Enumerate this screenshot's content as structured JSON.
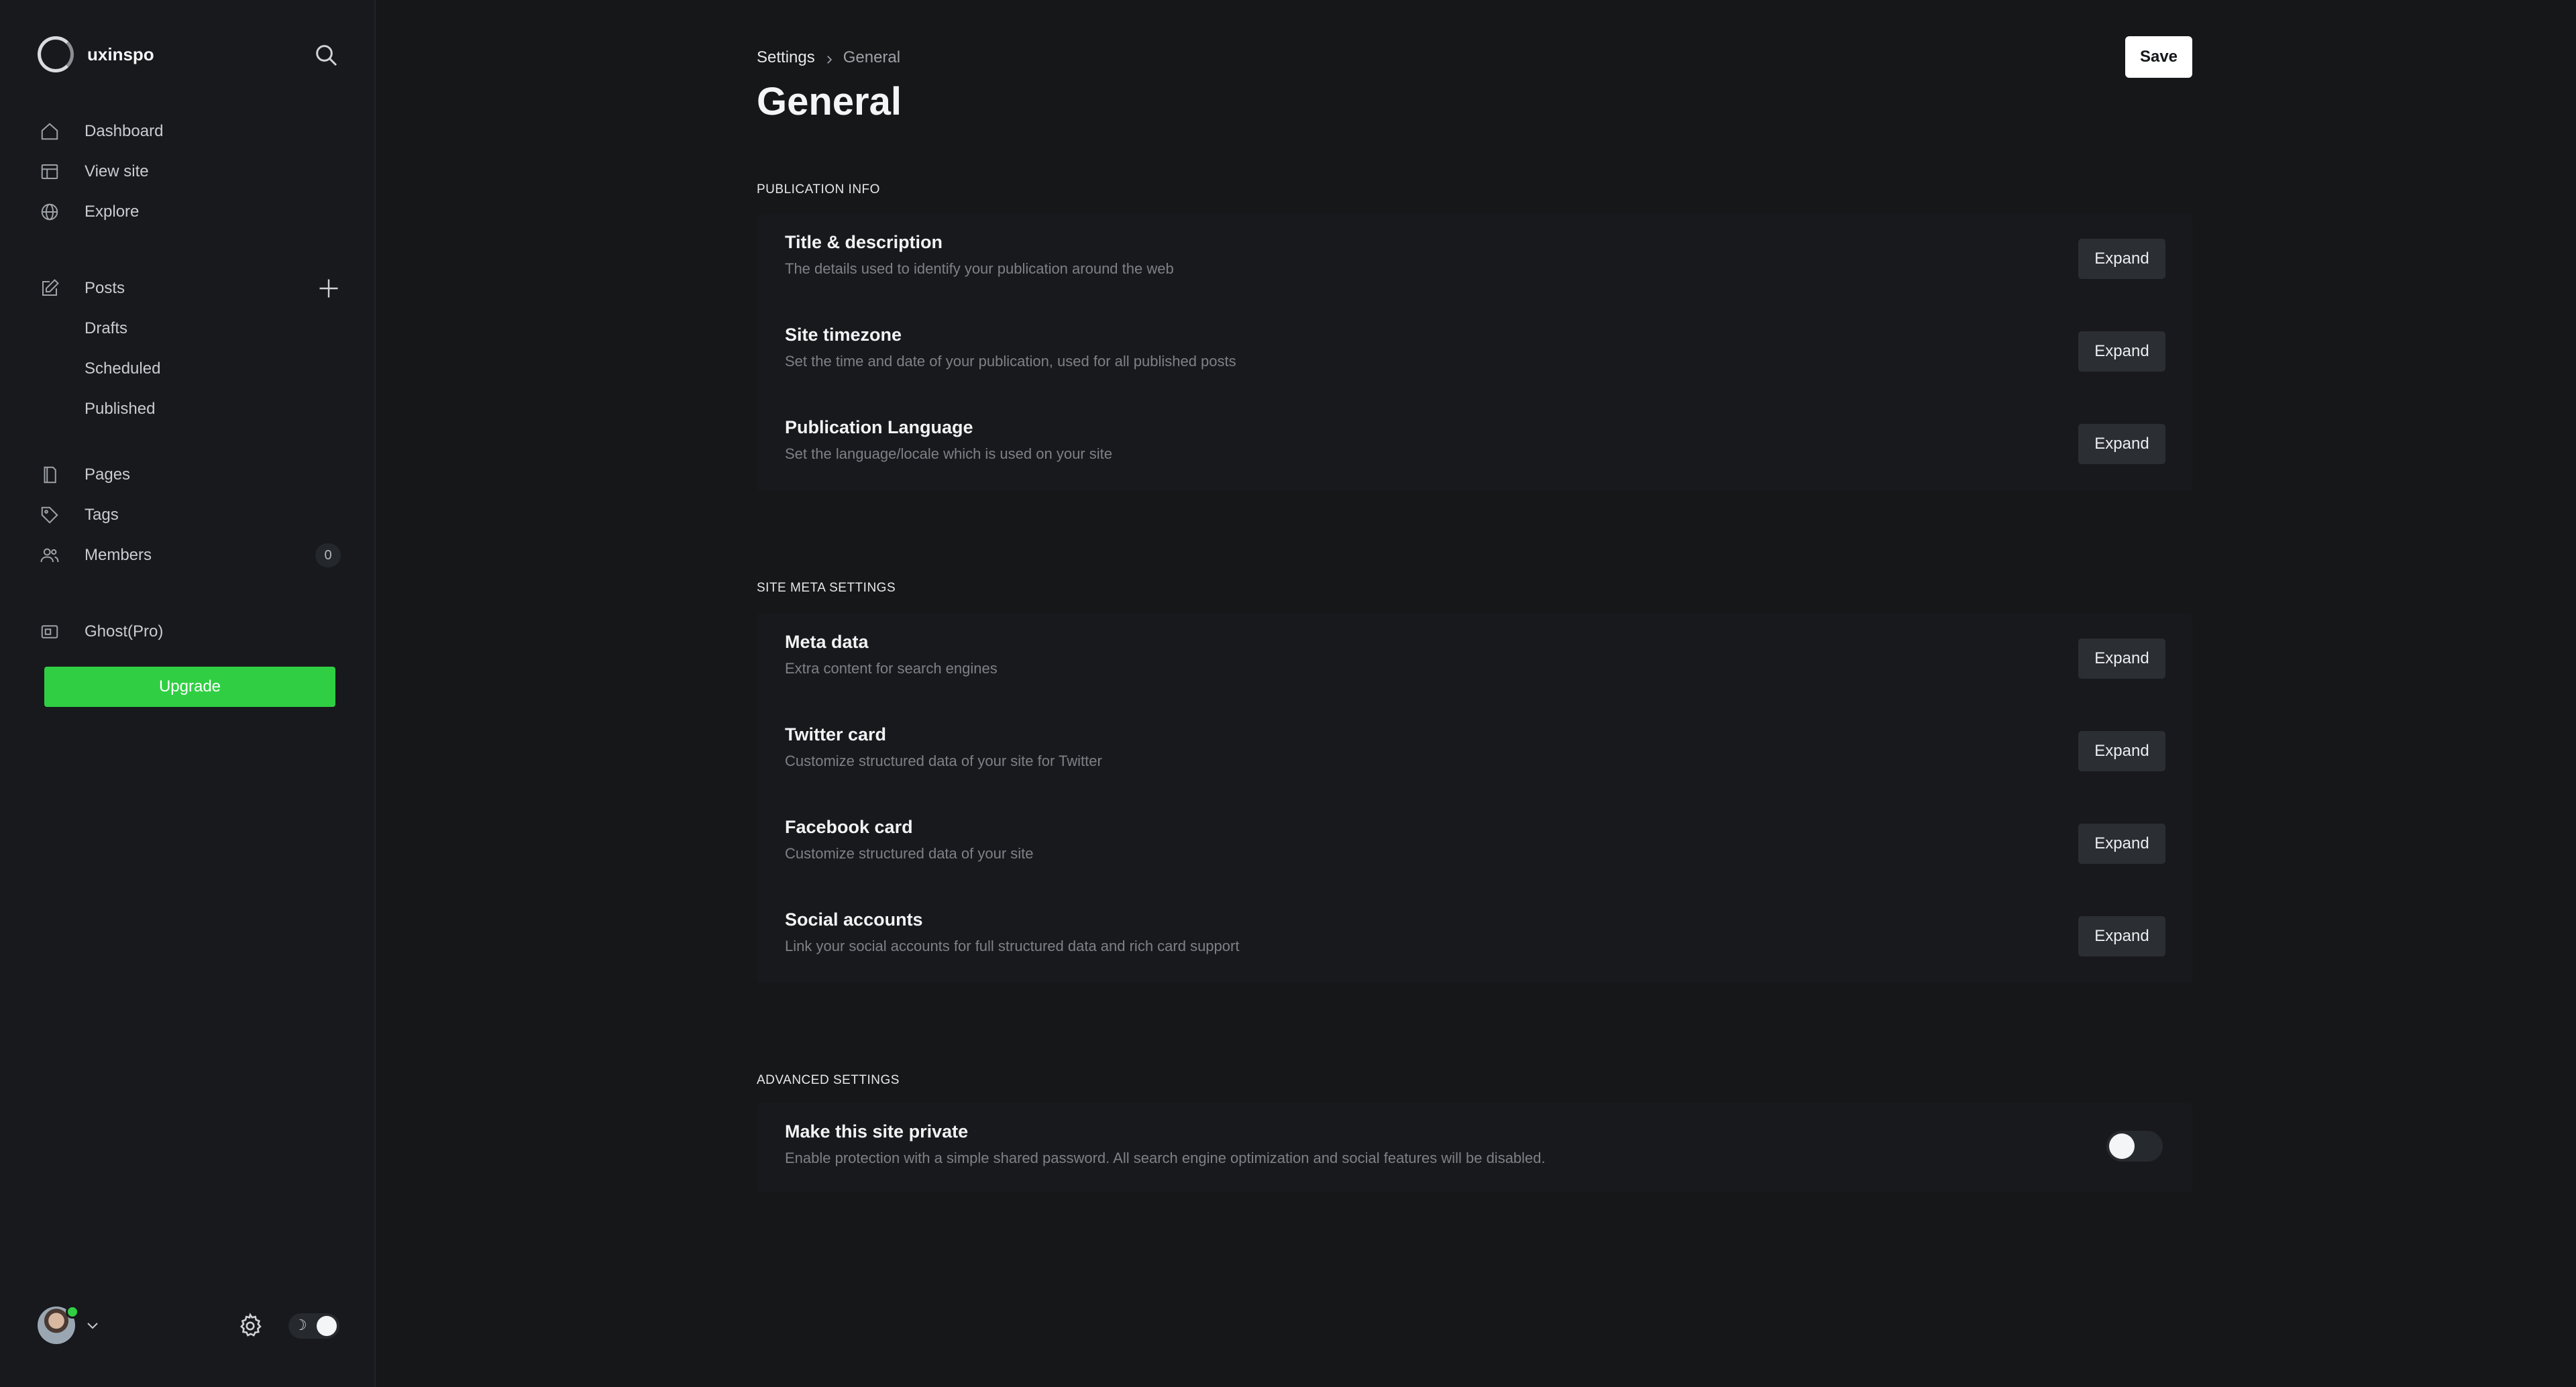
{
  "sidebar": {
    "brand": "uxinspo",
    "nav_primary": [
      {
        "label": "Dashboard",
        "icon": "home-icon"
      },
      {
        "label": "View site",
        "icon": "layout-icon"
      },
      {
        "label": "Explore",
        "icon": "globe-icon"
      }
    ],
    "posts": {
      "label": "Posts",
      "sub": [
        "Drafts",
        "Scheduled",
        "Published"
      ]
    },
    "nav_secondary": [
      {
        "label": "Pages",
        "icon": "page-icon"
      },
      {
        "label": "Tags",
        "icon": "tag-icon"
      },
      {
        "label": "Members",
        "icon": "members-icon",
        "badge": "0"
      }
    ],
    "ghost_pro": "Ghost(Pro)",
    "upgrade_label": "Upgrade",
    "accent_color": "#30cf43"
  },
  "header": {
    "breadcrumb_root": "Settings",
    "breadcrumb_current": "General",
    "title": "General",
    "save_label": "Save"
  },
  "sections": {
    "publication": {
      "label": "Publication info",
      "rows": [
        {
          "title": "Title & description",
          "desc": "The details used to identify your publication around the web",
          "action": "Expand"
        },
        {
          "title": "Site timezone",
          "desc": "Set the time and date of your publication, used for all published posts",
          "action": "Expand"
        },
        {
          "title": "Publication Language",
          "desc": "Set the language/locale which is used on your site",
          "action": "Expand"
        }
      ]
    },
    "meta": {
      "label": "Site meta settings",
      "rows": [
        {
          "title": "Meta data",
          "desc": "Extra content for search engines",
          "action": "Expand"
        },
        {
          "title": "Twitter card",
          "desc": "Customize structured data of your site for Twitter",
          "action": "Expand"
        },
        {
          "title": "Facebook card",
          "desc": "Customize structured data of your site",
          "action": "Expand"
        },
        {
          "title": "Social accounts",
          "desc": "Link your social accounts for full structured data and rich card support",
          "action": "Expand"
        }
      ]
    },
    "advanced": {
      "label": "Advanced settings",
      "rows": [
        {
          "title": "Make this site private",
          "desc": "Enable protection with a simple shared password. All search engine optimization and social features will be disabled.",
          "toggle_on": false
        }
      ]
    }
  }
}
